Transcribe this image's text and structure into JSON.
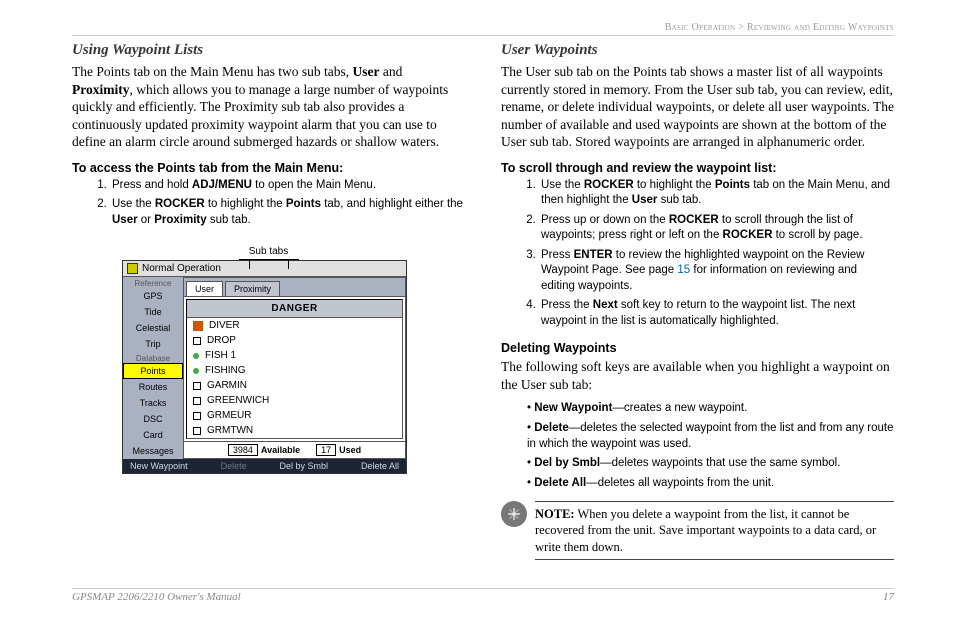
{
  "breadcrumb": {
    "left": "Basic Operation",
    "right": "Reviewing and Editing Waypoints",
    "sep": " > "
  },
  "left": {
    "h": "Using Waypoint Lists",
    "p": {
      "t1": "The Points tab on the Main Menu has two sub tabs, ",
      "b1": "User",
      "t2": " and ",
      "b2": "Proximity",
      "t3": ", which allows you to manage a large number of waypoints quickly and efficiently. The Proximity sub tab also provides a continuously updated proximity waypoint alarm that you can use to define an alarm circle around submerged hazards or shallow waters."
    },
    "sub": "To access the Points tab from the Main Menu:",
    "steps": {
      "s1": {
        "t1": "Press and hold ",
        "b1": "ADJ/MENU",
        "t2": " to open the Main Menu."
      },
      "s2": {
        "t1": "Use the ",
        "b1": "ROCKER",
        "t2": " to highlight the ",
        "b2": "Points",
        "t3": " tab, and highlight either the ",
        "b3": "User",
        "t4": " or ",
        "b4": "Proximity",
        "t5": " sub tab."
      }
    },
    "fig_label": "Sub tabs"
  },
  "device": {
    "title": "Normal Operation",
    "sidebar_cats": {
      "c1": "Reference",
      "c2": "Database"
    },
    "sidebar": [
      "GPS",
      "Tide",
      "Celestial",
      "Trip",
      "Points",
      "Routes",
      "Tracks",
      "DSC",
      "Card",
      "Messages"
    ],
    "selected": "Points",
    "tabs": {
      "user": "User",
      "prox": "Proximity"
    },
    "listhead": "DANGER",
    "items": [
      "DIVER",
      "DROP",
      "FISH 1",
      "FISHING",
      "GARMIN",
      "GREENWICH",
      "GRMEUR",
      "GRMTWN"
    ],
    "status": {
      "avail_n": "3984",
      "avail_l": "Available",
      "used_n": "17",
      "used_l": "Used"
    },
    "softkeys": {
      "k1": "New Waypoint",
      "k2": "Delete",
      "k3": "Del by Smbl",
      "k4": "Delete All"
    }
  },
  "right": {
    "h": "User Waypoints",
    "p": "The User sub tab on the Points tab shows a master list of all waypoints currently stored in memory. From the User sub tab, you can review, edit, rename, or delete individual waypoints, or delete all user waypoints. The number of available and used waypoints are shown at the bottom of the User sub tab. Stored waypoints are arranged in alphanumeric order.",
    "sub1": "To scroll through and review the waypoint list:",
    "steps": {
      "s1": {
        "t1": "Use the ",
        "b1": "ROCKER",
        "t2": " to highlight the ",
        "b2": "Points",
        "t3": " tab on the Main Menu, and then highlight the ",
        "b3": "User",
        "t4": " sub tab."
      },
      "s2": {
        "t1": "Press up or down on the ",
        "b1": "ROCKER",
        "t2": " to scroll through the list of waypoints; press right or left on the ",
        "b2": "ROCKER",
        "t3": " to scroll by page."
      },
      "s3": {
        "t1": "Press ",
        "b1": "ENTER",
        "t2": " to review the highlighted waypoint on the Review Waypoint Page. See page ",
        "pg": "15",
        "t3": " for information on reviewing and editing waypoints."
      },
      "s4": {
        "t1": "Press the ",
        "b1": "Next",
        "t2": " soft key to return to the waypoint list. The next waypoint in the list is automatically highlighted."
      }
    },
    "sub2": "Deleting Waypoints",
    "p2": "The following soft keys are available when you highlight a waypoint on the User sub tab:",
    "bullets": {
      "b1": {
        "b": "New Waypoint",
        "t": "—creates a new waypoint."
      },
      "b2": {
        "b": "Delete",
        "t": "—deletes the selected waypoint from the list and from any route in which the waypoint was used."
      },
      "b3": {
        "b": "Del by Smbl",
        "t": "—deletes waypoints that use the same symbol."
      },
      "b4": {
        "b": "Delete All",
        "t": "—deletes all waypoints from the unit."
      }
    },
    "note": {
      "lead": "NOTE:",
      "t": " When you delete a waypoint from the list, it cannot be recovered from the unit. Save important waypoints to a data card, or write them down."
    }
  },
  "footer": {
    "left": "GPSMAP 2206/2210 Owner's Manual",
    "right": "17"
  }
}
